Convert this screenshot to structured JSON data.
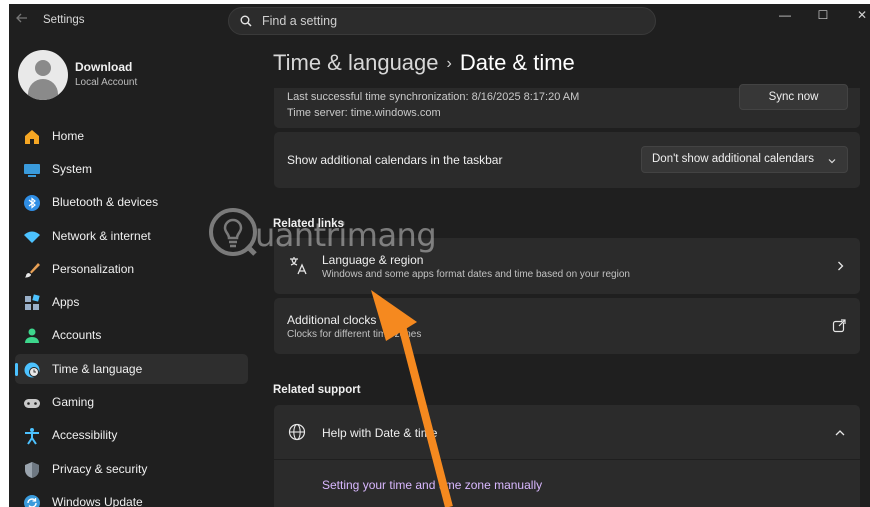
{
  "window": {
    "app_title": "Settings",
    "minimize_glyph": "—",
    "maximize_glyph": "☐",
    "close_glyph": "✕"
  },
  "search": {
    "placeholder": "Find a setting"
  },
  "user": {
    "name": "Download",
    "account_type": "Local Account"
  },
  "sidebar": {
    "items": [
      {
        "label": "Home",
        "icon": "home-icon",
        "color": "#f5a623"
      },
      {
        "label": "System",
        "icon": "system-icon",
        "color": "#3a9bdc"
      },
      {
        "label": "Bluetooth & devices",
        "icon": "bluetooth-icon",
        "color": "#2f8ee5"
      },
      {
        "label": "Network & internet",
        "icon": "wifi-icon",
        "color": "#4cc2ff"
      },
      {
        "label": "Personalization",
        "icon": "brush-icon",
        "color": "#e8a055"
      },
      {
        "label": "Apps",
        "icon": "apps-icon",
        "color": "#9ab0c9"
      },
      {
        "label": "Accounts",
        "icon": "accounts-icon",
        "color": "#3dd68c"
      },
      {
        "label": "Time & language",
        "icon": "globe-clock-icon",
        "color": "#4cc2ff",
        "active": true
      },
      {
        "label": "Gaming",
        "icon": "gamepad-icon",
        "color": "#c8c8c8"
      },
      {
        "label": "Accessibility",
        "icon": "accessibility-icon",
        "color": "#4cc2ff"
      },
      {
        "label": "Privacy & security",
        "icon": "shield-icon",
        "color": "#9aa4ae"
      },
      {
        "label": "Windows Update",
        "icon": "update-icon",
        "color": "#3a9bdc"
      }
    ]
  },
  "breadcrumb": {
    "parent": "Time & language",
    "separator": "›",
    "current": "Date & time"
  },
  "sync": {
    "last_sync": "Last successful time synchronization: 8/16/2025 8:17:20 AM",
    "time_server": "Time server: time.windows.com",
    "button_label": "Sync now"
  },
  "calendars": {
    "label": "Show additional calendars in the taskbar",
    "selected": "Don't show additional calendars"
  },
  "related_links": {
    "heading": "Related links",
    "items": [
      {
        "title": "Language & region",
        "subtitle": "Windows and some apps format dates and time based on your region"
      },
      {
        "title": "Additional clocks",
        "subtitle": "Clocks for different time zones"
      }
    ]
  },
  "related_support": {
    "heading": "Related support",
    "help_title": "Help with Date & time",
    "link": "Setting your time and time zone manually"
  },
  "watermark": {
    "text": "uantrimang"
  },
  "colors": {
    "background": "#1f1f1f",
    "card": "#2b2b2b",
    "accent": "#4cc2ff",
    "link": "#d9b8ff",
    "arrow": "#f5891f"
  }
}
